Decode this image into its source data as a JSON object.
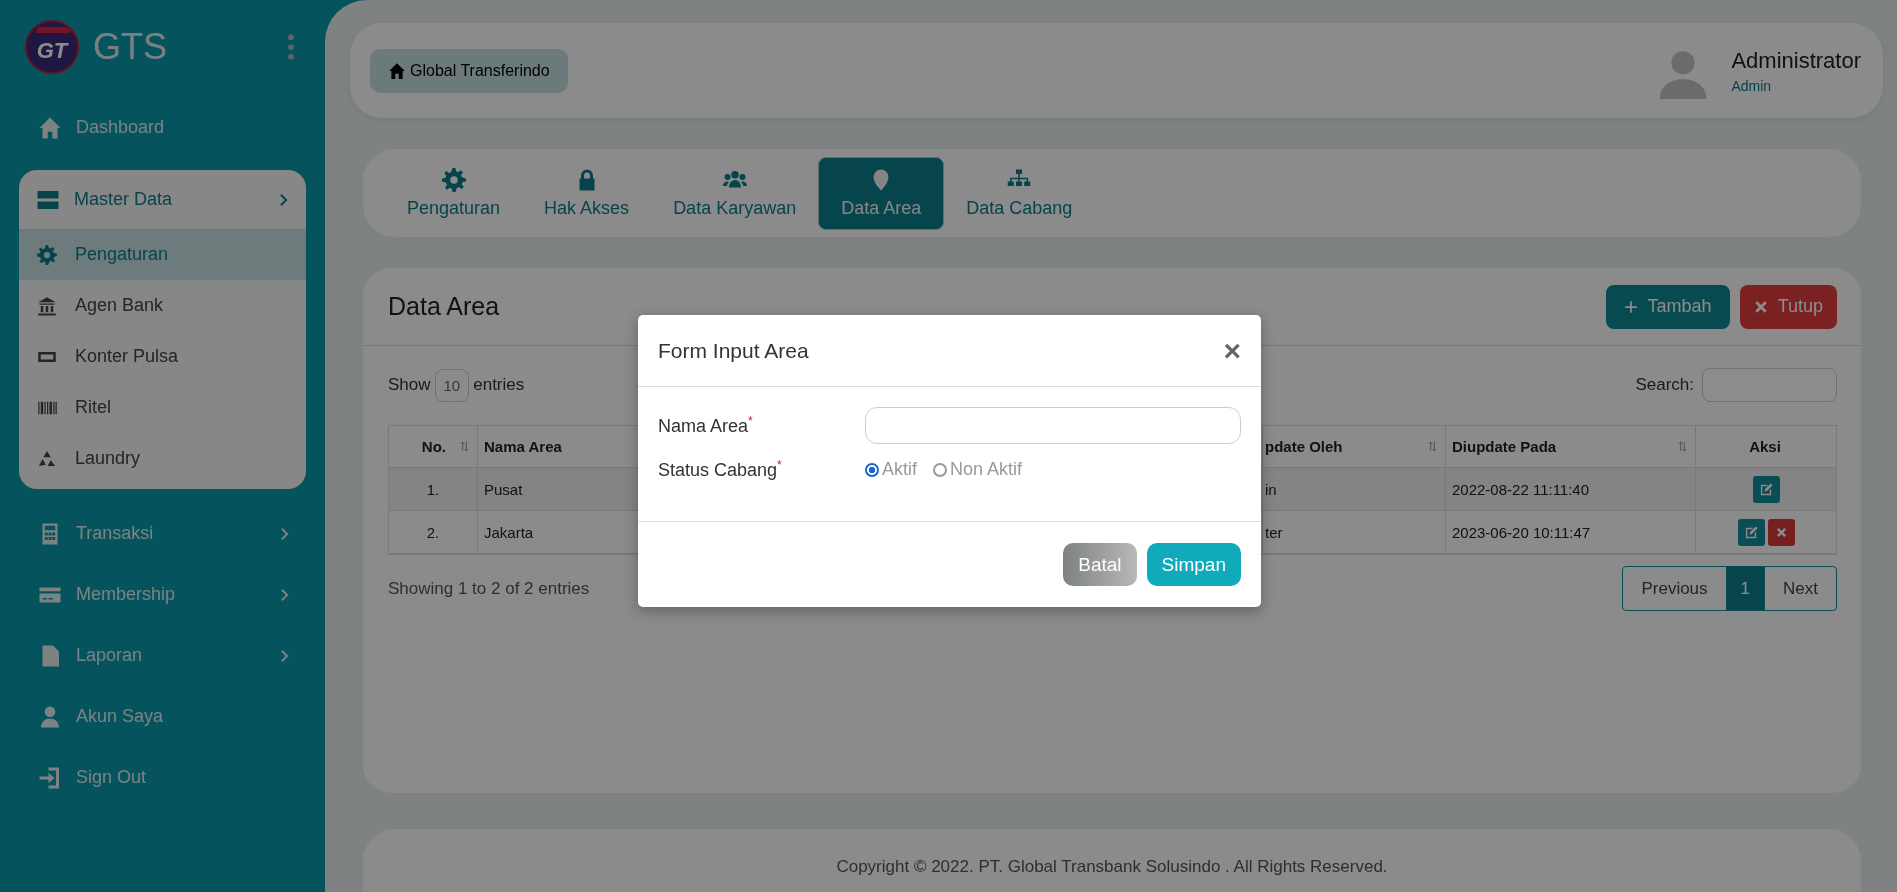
{
  "brand": {
    "logo_text": "GT",
    "name": "GTS"
  },
  "sidebar": {
    "items": [
      {
        "label": "Dashboard",
        "has_submenu": false,
        "expanded": false
      },
      {
        "label": "Master Data",
        "has_submenu": true,
        "expanded": true,
        "children": [
          {
            "label": "Pengaturan",
            "selected": true
          },
          {
            "label": "Agen Bank",
            "selected": false
          },
          {
            "label": "Konter Pulsa",
            "selected": false
          },
          {
            "label": "Ritel",
            "selected": false
          },
          {
            "label": "Laundry",
            "selected": false
          }
        ]
      },
      {
        "label": "Transaksi",
        "has_submenu": true,
        "expanded": false
      },
      {
        "label": "Membership",
        "has_submenu": true,
        "expanded": false
      },
      {
        "label": "Laporan",
        "has_submenu": true,
        "expanded": false
      },
      {
        "label": "Akun Saya",
        "has_submenu": false,
        "expanded": false
      },
      {
        "label": "Sign Out",
        "has_submenu": false,
        "expanded": false
      }
    ]
  },
  "header": {
    "company_button": "Global Transferindo",
    "user_name": "Administrator",
    "user_role": "Admin"
  },
  "tabs": [
    {
      "label": "Pengaturan",
      "selected": false
    },
    {
      "label": "Hak Akses",
      "selected": false
    },
    {
      "label": "Data Karyawan",
      "selected": false
    },
    {
      "label": "Data Area",
      "selected": true
    },
    {
      "label": "Data Cabang",
      "selected": false
    }
  ],
  "panel": {
    "title": "Data Area",
    "add_button": "Tambah",
    "close_button": "Tutup",
    "show_label": "Show",
    "page_size": "10",
    "entries_label": "entries",
    "search_label": "Search:",
    "info": "Showing 1 to 2 of 2 entries"
  },
  "table": {
    "columns": [
      {
        "label": "No.",
        "sortable": true
      },
      {
        "label": "Nama Area"
      },
      {
        "label": "pdate Oleh",
        "sortable": true
      },
      {
        "label": "Diupdate Pada",
        "sortable": true
      },
      {
        "label": "Aksi",
        "sortable": false
      }
    ],
    "rows": [
      {
        "no": "1.",
        "name": "Pusat",
        "updated_by": "in",
        "updated_at": "2022-08-22 11:11:40",
        "actions": [
          {
            "kind": "edit"
          }
        ]
      },
      {
        "no": "2.",
        "name": "Jakarta",
        "updated_by": "ter",
        "updated_at": "2023-06-20 10:11:47",
        "actions": [
          {
            "kind": "edit"
          },
          {
            "kind": "delete"
          }
        ]
      }
    ]
  },
  "pagination": {
    "previous": "Previous",
    "pages": [
      {
        "label": "1",
        "selected": true
      }
    ],
    "next": "Next"
  },
  "footer": "Copyright © 2022. PT. Global Transbank Solusindo . All Rights Reserved.",
  "modal": {
    "title": "Form Input Area",
    "close": "×",
    "fields": [
      {
        "label": "Nama Area",
        "required_mark": "*",
        "kind": "text"
      },
      {
        "label": "Status Cabang",
        "required_mark": "*",
        "kind": "radio",
        "options": [
          {
            "label": "Aktif",
            "selected": true
          },
          {
            "label": "Non Aktif",
            "selected": false
          }
        ]
      }
    ],
    "cancel_button": "Batal",
    "save_button": "Simpan"
  }
}
